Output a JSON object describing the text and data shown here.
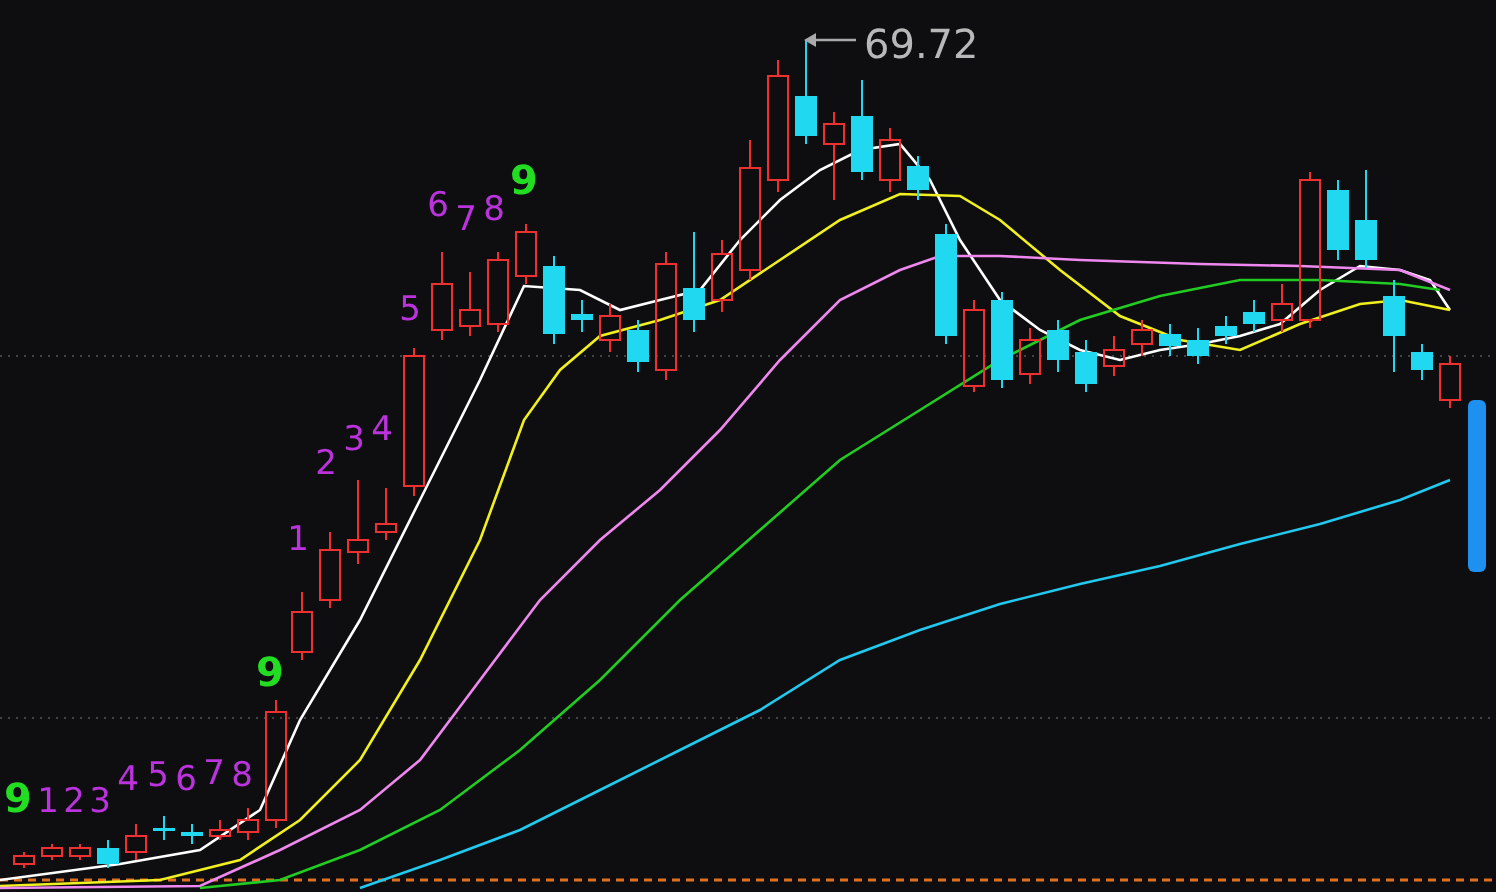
{
  "chart": {
    "high_marker": "69.72",
    "sequence_labels": [
      {
        "text": "9",
        "color": "#22dd22"
      },
      {
        "text": "1",
        "color": "#bb33dd"
      },
      {
        "text": "2",
        "color": "#bb33dd"
      },
      {
        "text": "3",
        "color": "#bb33dd"
      },
      {
        "text": "4",
        "color": "#bb33dd"
      },
      {
        "text": "5",
        "color": "#bb33dd"
      },
      {
        "text": "6",
        "color": "#bb33dd"
      },
      {
        "text": "7",
        "color": "#bb33dd"
      },
      {
        "text": "8",
        "color": "#bb33dd"
      },
      {
        "text": "9",
        "color": "#22dd22"
      },
      {
        "text": "1",
        "color": "#bb33dd"
      },
      {
        "text": "2",
        "color": "#bb33dd"
      },
      {
        "text": "3",
        "color": "#bb33dd"
      },
      {
        "text": "4",
        "color": "#bb33dd"
      },
      {
        "text": "5",
        "color": "#bb33dd"
      },
      {
        "text": "6",
        "color": "#bb33dd"
      },
      {
        "text": "7",
        "color": "#bb33dd"
      },
      {
        "text": "8",
        "color": "#bb33dd"
      },
      {
        "text": "9",
        "color": "#22dd22"
      }
    ]
  }
}
